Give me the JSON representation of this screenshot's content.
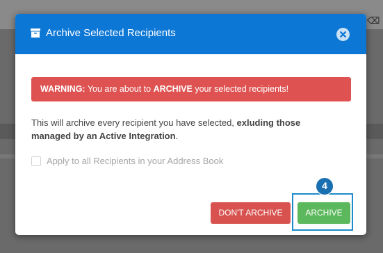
{
  "modal": {
    "title": "Archive Selected Recipients",
    "close_icon": "close-circle-icon",
    "header_icon": "archive-box-icon"
  },
  "warning": {
    "label": "WARNING:",
    "text_before": " You are about to ",
    "emphasis": "ARCHIVE",
    "text_after": " your selected recipients!"
  },
  "description": {
    "text": "This will archive every recipient you have selected, ",
    "bold": "exluding those managed by an Active Integration",
    "end": "."
  },
  "checkbox": {
    "label": "Apply to all Recipients in your Address Book",
    "checked": false
  },
  "buttons": {
    "dont_archive": "DON'T ARCHIVE",
    "archive": "ARCHIVE"
  },
  "callout": {
    "number": "4"
  },
  "colors": {
    "header": "#0d77d5",
    "warning": "#de5352",
    "dont_archive": "#d85350",
    "archive": "#5cb85c",
    "callout": "#1a6fb0"
  }
}
